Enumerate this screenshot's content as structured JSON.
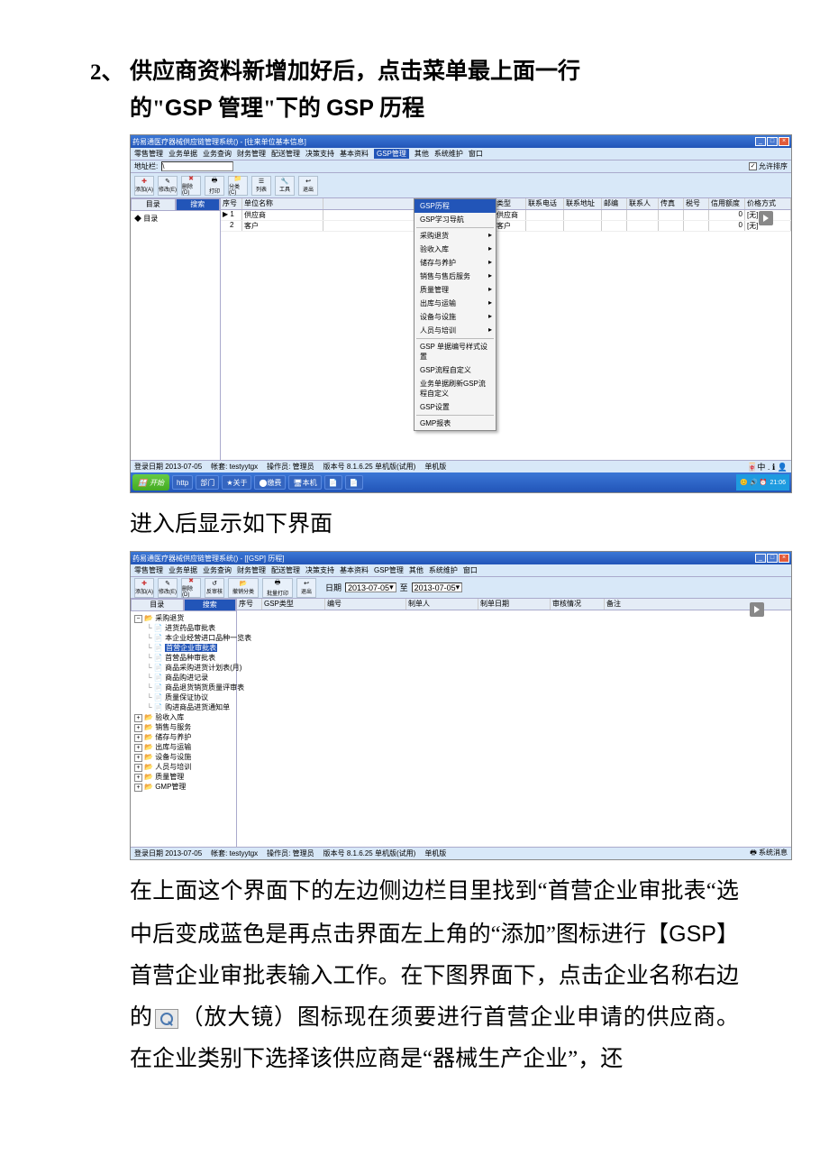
{
  "step": {
    "number": "2、",
    "line1a": "供应商资料新增加好后，点击菜单最上面一行",
    "line2a": "的\"",
    "line2b": "GSP",
    "line2c": " 管理\"下的 ",
    "line2d": "GSP",
    "line2e": " 历程"
  },
  "shot1": {
    "title": "药易通医疗器械供应链管理系统() - [往来单位基本信息]",
    "menus": [
      "零售管理",
      "业务单据",
      "业务查询",
      "财务管理",
      "配送管理",
      "决策支持",
      "基本资料"
    ],
    "menu_hl": "GSP管理",
    "menus_tail": [
      "其他",
      "系统维护",
      "窗口"
    ],
    "addr_label": "地址栏:",
    "addr_val": "\\",
    "sort_label": "允许排序",
    "toolbar_labels": [
      "添加(A)",
      "修改(E)",
      "删除(D)",
      "打印",
      "分类(C)",
      "列表",
      "工具",
      "退出"
    ],
    "tabs": [
      "目录",
      "搜索"
    ],
    "tree_items": [
      "目录"
    ],
    "grid_cols": [
      "序号",
      "单位名称",
      "",
      "类型",
      "联系电话",
      "联系地址",
      "邮编",
      "联系人",
      "传真",
      "税号",
      "信用额度",
      "价格方式"
    ],
    "rows": [
      {
        "no": "1",
        "name": "供应商",
        "type": "供应商",
        "credit": "0",
        "price": "[无]"
      },
      {
        "no": "2",
        "name": "客户",
        "type": "客户",
        "credit": "0",
        "price": "[无]"
      }
    ],
    "dropdown": [
      {
        "t": "GSP历程",
        "hl": true
      },
      {
        "t": "GSP学习导航"
      },
      {
        "sep": true
      },
      {
        "t": "采购退货",
        "arr": true
      },
      {
        "t": "验收入库",
        "arr": true
      },
      {
        "t": "储存与养护",
        "arr": true
      },
      {
        "t": "销售与售后服务",
        "arr": true
      },
      {
        "t": "质量管理",
        "arr": true
      },
      {
        "t": "出库与运输",
        "arr": true
      },
      {
        "t": "设备与设施",
        "arr": true
      },
      {
        "t": "人员与培训",
        "arr": true
      },
      {
        "sep": true
      },
      {
        "t": "GSP 单据编号样式设置"
      },
      {
        "t": "GSP流程自定义"
      },
      {
        "t": "业务单据刷新GSP流程自定义"
      },
      {
        "t": "GSP设置"
      },
      {
        "sep": true
      },
      {
        "t": "GMP报表"
      }
    ],
    "status": {
      "login": "登录日期 2013-07-05",
      "acct": "帐套: testyytgx",
      "oper": "操作员: 管理员",
      "ver": "版本号 8.1.6.25 单机版(试用)",
      "mode": "单机版"
    },
    "taskbar": {
      "start": "开始",
      "tasks": [
        "部门",
        "关于",
        "缴费",
        "本机"
      ],
      "tray_text": "21:06"
    }
  },
  "mid_para": "进入后显示如下界面",
  "shot2": {
    "title": "药易通医疗器械供应链管理系统() - [[GSP] 历程]",
    "menus": [
      "零售管理",
      "业务单据",
      "业务查询",
      "财务管理",
      "配送管理",
      "决策支持",
      "基本资料",
      "GSP管理",
      "其他",
      "系统维护",
      "窗口"
    ],
    "toolbar_labels": [
      "添加(A)",
      "修改(E)",
      "删除(D)",
      "反审核",
      "撤销分类",
      "批量打印",
      "退出"
    ],
    "date_label": "日期",
    "date_from": "2013-07-05",
    "date_to": "2013-07-05",
    "tabs": [
      "目录",
      "搜索"
    ],
    "grid_cols": [
      "序号",
      "GSP类型",
      "编号",
      "制单人",
      "制单日期",
      "审核情况",
      "备注"
    ],
    "tree": {
      "root": "采购退货",
      "children": [
        "进货药品审批表",
        "本企业经营进口品种一览表",
        "首营企业审批表",
        "首营品种审批表",
        "商品采购进货计划表(月)",
        "商品购进记录",
        "商品退货销货质量评审表",
        "质量保证协议",
        "购进商品进货通知单"
      ],
      "rest": [
        "验收入库",
        "销售与服务",
        "储存与养护",
        "出库与运输",
        "设备与设施",
        "人员与培训",
        "质量管理",
        "GMP管理"
      ]
    },
    "status": {
      "login": "登录日期 2013-07-05",
      "acct": "帐套: testyytgx",
      "oper": "操作员: 管理员",
      "ver": "版本号 8.1.6.25 单机版(试用)",
      "mode": "单机版",
      "tray": "系统消息"
    }
  },
  "body_text": {
    "p1": "在上面这个界面下的左边侧边栏目里找到“首营企业审批表“选中后变成蓝色是再点击界面左上角的“添加”图标进行【",
    "p1b": "GSP",
    "p1c": "】首营企业审批表输入工作。在下图界面下，点击企业名称右边的",
    "p2": "（放大镜）图标现在须要进行首营企业申请的供应商。在企业类别下选择该供应商是“器械生产企业”，还"
  }
}
